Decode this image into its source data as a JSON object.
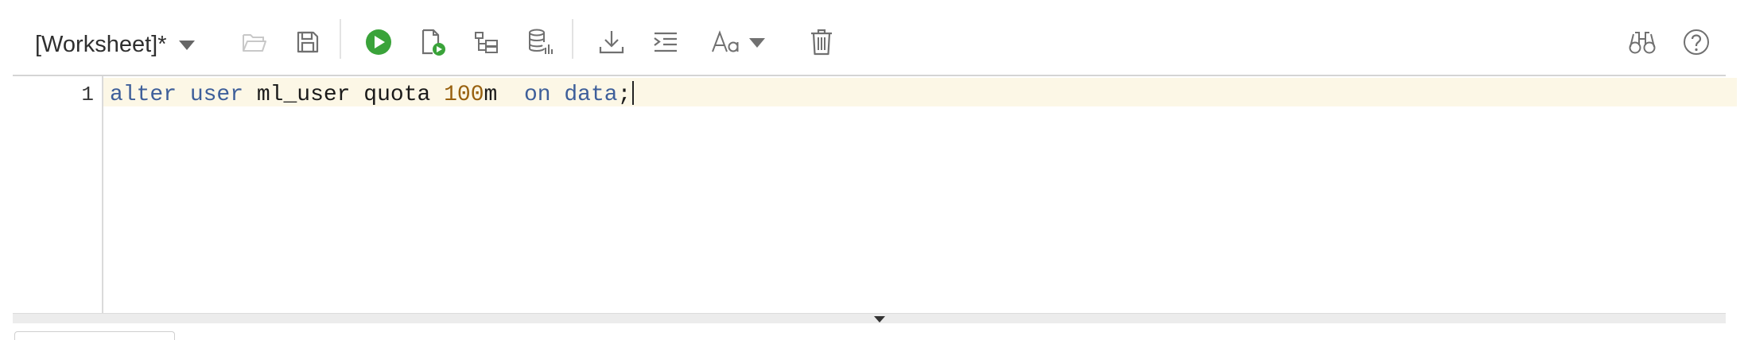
{
  "toolbar": {
    "worksheet_label": "[Worksheet]*",
    "icons": [
      "chevron-down-icon",
      "open-folder-icon",
      "save-icon",
      "run-statement-icon",
      "run-script-icon",
      "explain-plan-icon",
      "autotrace-icon",
      "download-icon",
      "format-icon",
      "case-icon",
      "chevron-down-icon",
      "trash-icon",
      "binoculars-icon",
      "help-icon"
    ]
  },
  "editor": {
    "line_number": "1",
    "tokens": {
      "t1": "alter",
      "t2": "user",
      "t3": "ml_user quota ",
      "t4": "100",
      "t5": "m  ",
      "t6": "on",
      "t7": " ",
      "t8": "data",
      "t9": ";"
    }
  },
  "colors": {
    "keyword": "#3e5f9a",
    "number": "#98610f",
    "current_line": "#fcf7e6",
    "run_green": "#3aa33a"
  }
}
